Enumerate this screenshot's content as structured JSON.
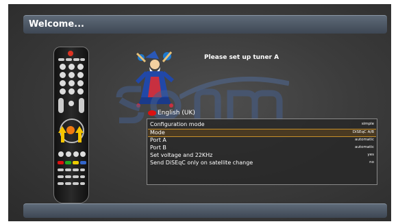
{
  "header": {
    "title": "Welcome..."
  },
  "wizard": {
    "prompt": "Please set up tuner A"
  },
  "language": {
    "label": "English (UK)"
  },
  "config": {
    "rows": [
      {
        "label": "Configuration mode",
        "value": "simple"
      },
      {
        "label": "Mode",
        "value": "DiSEqC A/B"
      },
      {
        "label": "Port A",
        "value": "automatic"
      },
      {
        "label": "Port B",
        "value": "automatic"
      },
      {
        "label": "Set voltage and 22KHz",
        "value": "yes"
      },
      {
        "label": "Send DiSEqC only on satellite change",
        "value": "no"
      }
    ],
    "selected_index": 1
  },
  "colors": {
    "selection_border": "#c8902a",
    "bar": "#4e5866",
    "red_key": "#d11111"
  },
  "icons": [
    "remote-control-icon",
    "wizard-mascot-icon",
    "language-flag-icon"
  ]
}
